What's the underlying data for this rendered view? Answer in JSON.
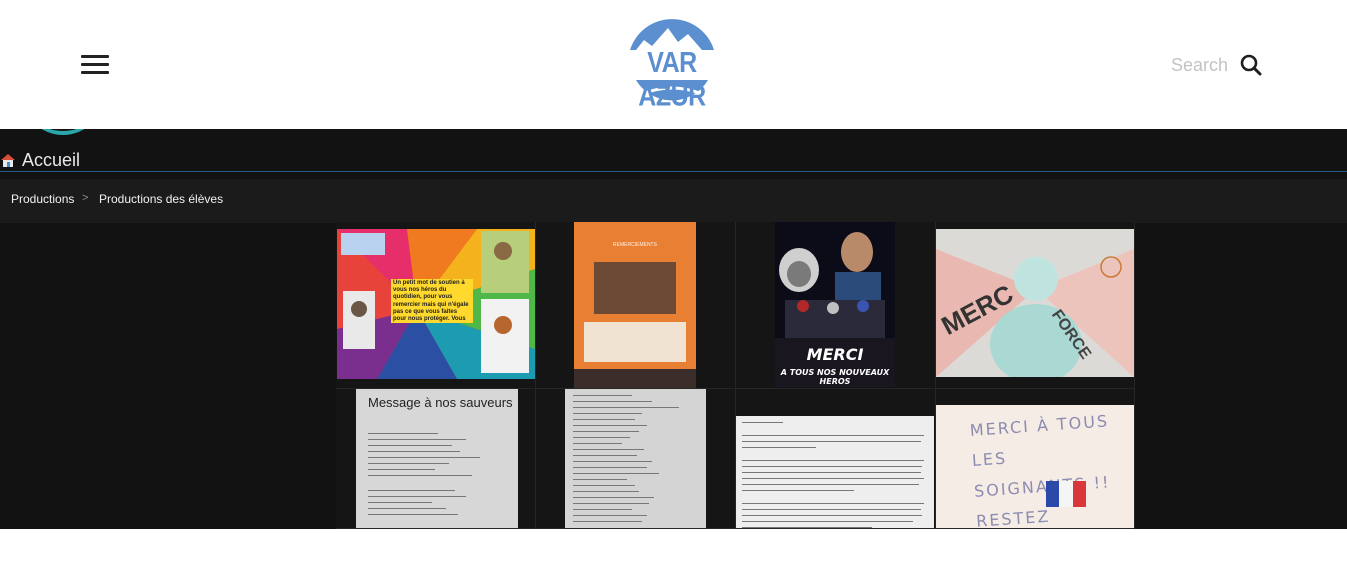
{
  "header": {
    "logo_text": "VAR AZUR",
    "search_label": "Search",
    "menu_icon": "hamburger-icon",
    "search_icon": "magnifier-icon",
    "brand_color": "#5b8fcf"
  },
  "screen": {
    "home_label": "Accueil",
    "breadcrumb": {
      "first": "Productions",
      "separator": ">",
      "second": "Productions des élèves"
    }
  },
  "gallery": {
    "items": [
      {
        "caption": ""
      },
      {
        "caption": "REMERCIEMENTS"
      },
      {
        "caption": "MERCI",
        "subcaption": "A TOUS NOS NOUVEAUX HEROS"
      },
      {
        "caption": "MERCI SANTÉ-FORCE"
      },
      {
        "caption": "Message à nos sauveurs"
      },
      {
        "caption": ""
      },
      {
        "caption": ""
      },
      {
        "caption": "MERCI À TOUS LES SOIGNANTS !! RESTEZ FORTS !"
      }
    ],
    "poster_message": "Un petit mot de soutien à vous nos héros du quotidien, pour vous remercier mais qui n'égale pas ce que vous faites pour nous protéger. Vous veillez sur nous donc on pense à vous en restant chez nous"
  }
}
